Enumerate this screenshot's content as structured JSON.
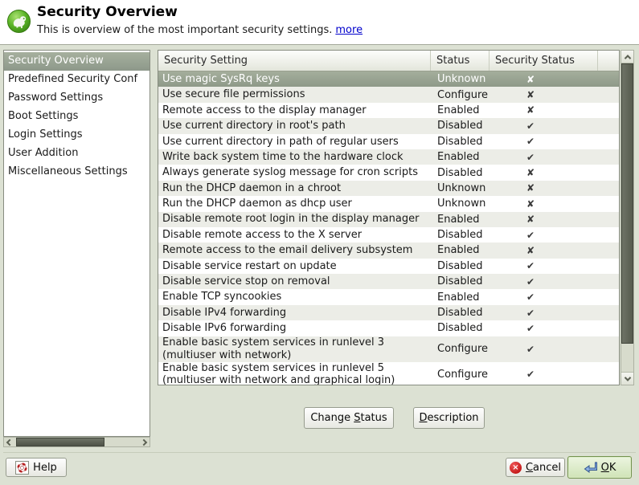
{
  "window": {
    "title": "Security Overview"
  },
  "header": {
    "title": "Security Overview",
    "subtitle": "This is overview of the most important security settings.",
    "more_link": "more",
    "icon": "yast-security-suse-geeko-icon"
  },
  "sidebar": {
    "items": [
      {
        "label": "Security Overview",
        "selected": true
      },
      {
        "label": "Predefined Security Conf"
      },
      {
        "label": "Password Settings"
      },
      {
        "label": "Boot Settings"
      },
      {
        "label": "Login Settings"
      },
      {
        "label": "User Addition"
      },
      {
        "label": "Miscellaneous Settings"
      }
    ]
  },
  "table": {
    "columns": [
      "Security Setting",
      "Status",
      "Security Status"
    ],
    "icons": {
      "check": "✔",
      "cross": "✘"
    },
    "rows": [
      {
        "setting": "Use magic SysRq keys",
        "status": "Unknown",
        "secure": false,
        "selected": true
      },
      {
        "setting": "Use secure file permissions",
        "status": "Configure",
        "secure": false
      },
      {
        "setting": "Remote access to the display manager",
        "status": "Enabled",
        "secure": false
      },
      {
        "setting": "Use current directory in root's path",
        "status": "Disabled",
        "secure": true
      },
      {
        "setting": "Use current directory in path of regular users",
        "status": "Disabled",
        "secure": true
      },
      {
        "setting": "Write back system time to the hardware clock",
        "status": "Enabled",
        "secure": true
      },
      {
        "setting": "Always generate syslog message for cron scripts",
        "status": "Disabled",
        "secure": false
      },
      {
        "setting": "Run the DHCP daemon in a chroot",
        "status": "Unknown",
        "secure": false
      },
      {
        "setting": "Run the DHCP daemon as dhcp user",
        "status": "Unknown",
        "secure": false
      },
      {
        "setting": "Disable remote root login in the display manager",
        "status": "Enabled",
        "secure": false
      },
      {
        "setting": "Disable remote access to the X server",
        "status": "Disabled",
        "secure": true
      },
      {
        "setting": "Remote access to the email delivery subsystem",
        "status": "Enabled",
        "secure": false
      },
      {
        "setting": "Disable service restart on update",
        "status": "Disabled",
        "secure": true
      },
      {
        "setting": "Disable service stop on removal",
        "status": "Disabled",
        "secure": true
      },
      {
        "setting": "Enable TCP syncookies",
        "status": "Enabled",
        "secure": true
      },
      {
        "setting": "Disable IPv4 forwarding",
        "status": "Disabled",
        "secure": true
      },
      {
        "setting": "Disable IPv6 forwarding",
        "status": "Disabled",
        "secure": true
      },
      {
        "setting": "Enable basic system services in runlevel 3",
        "setting2": " (multiuser with network)",
        "status": "Configure",
        "secure": true
      },
      {
        "setting": "Enable basic system services in runlevel 5",
        "setting2": " (multiuser with network and graphical login)",
        "status": "Configure",
        "secure": true
      }
    ]
  },
  "buttons": {
    "change_status": {
      "pre": "Change ",
      "mn": "S",
      "post": "tatus"
    },
    "description": {
      "pre": "",
      "mn": "D",
      "post": "escription"
    },
    "help": {
      "label": "Help"
    },
    "cancel": {
      "pre": "",
      "mn": "C",
      "post": "ancel",
      "icon_glyph": "×"
    },
    "ok": {
      "pre": "",
      "mn": "O",
      "post": "K"
    }
  },
  "colors": {
    "window_bg": "#dce1d3",
    "selection_bg": "#96a18e",
    "link_blue": "#0000cc",
    "ok_button_green": "#cfe3b7",
    "cancel_icon_red": "#b40000",
    "scrollbar_thumb": "#565b4e"
  }
}
